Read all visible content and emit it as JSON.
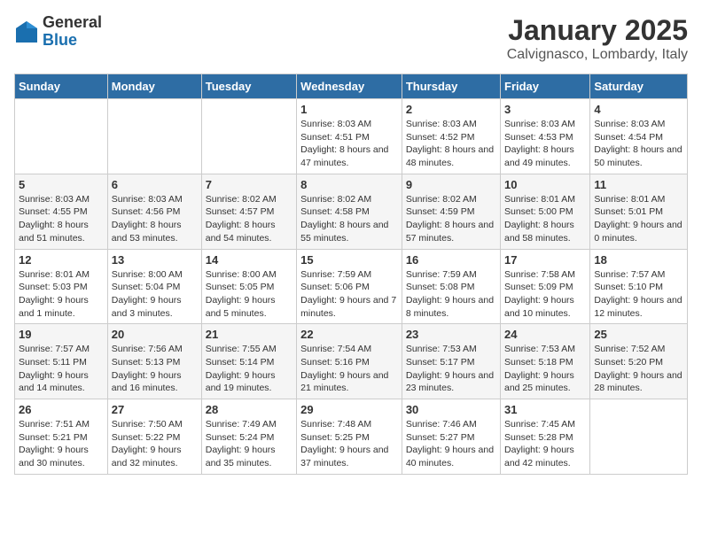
{
  "header": {
    "logo_general": "General",
    "logo_blue": "Blue",
    "month": "January 2025",
    "location": "Calvignasco, Lombardy, Italy"
  },
  "weekdays": [
    "Sunday",
    "Monday",
    "Tuesday",
    "Wednesday",
    "Thursday",
    "Friday",
    "Saturday"
  ],
  "weeks": [
    [
      {
        "day": "",
        "info": ""
      },
      {
        "day": "",
        "info": ""
      },
      {
        "day": "",
        "info": ""
      },
      {
        "day": "1",
        "info": "Sunrise: 8:03 AM\nSunset: 4:51 PM\nDaylight: 8 hours and 47 minutes."
      },
      {
        "day": "2",
        "info": "Sunrise: 8:03 AM\nSunset: 4:52 PM\nDaylight: 8 hours and 48 minutes."
      },
      {
        "day": "3",
        "info": "Sunrise: 8:03 AM\nSunset: 4:53 PM\nDaylight: 8 hours and 49 minutes."
      },
      {
        "day": "4",
        "info": "Sunrise: 8:03 AM\nSunset: 4:54 PM\nDaylight: 8 hours and 50 minutes."
      }
    ],
    [
      {
        "day": "5",
        "info": "Sunrise: 8:03 AM\nSunset: 4:55 PM\nDaylight: 8 hours and 51 minutes."
      },
      {
        "day": "6",
        "info": "Sunrise: 8:03 AM\nSunset: 4:56 PM\nDaylight: 8 hours and 53 minutes."
      },
      {
        "day": "7",
        "info": "Sunrise: 8:02 AM\nSunset: 4:57 PM\nDaylight: 8 hours and 54 minutes."
      },
      {
        "day": "8",
        "info": "Sunrise: 8:02 AM\nSunset: 4:58 PM\nDaylight: 8 hours and 55 minutes."
      },
      {
        "day": "9",
        "info": "Sunrise: 8:02 AM\nSunset: 4:59 PM\nDaylight: 8 hours and 57 minutes."
      },
      {
        "day": "10",
        "info": "Sunrise: 8:01 AM\nSunset: 5:00 PM\nDaylight: 8 hours and 58 minutes."
      },
      {
        "day": "11",
        "info": "Sunrise: 8:01 AM\nSunset: 5:01 PM\nDaylight: 9 hours and 0 minutes."
      }
    ],
    [
      {
        "day": "12",
        "info": "Sunrise: 8:01 AM\nSunset: 5:03 PM\nDaylight: 9 hours and 1 minute."
      },
      {
        "day": "13",
        "info": "Sunrise: 8:00 AM\nSunset: 5:04 PM\nDaylight: 9 hours and 3 minutes."
      },
      {
        "day": "14",
        "info": "Sunrise: 8:00 AM\nSunset: 5:05 PM\nDaylight: 9 hours and 5 minutes."
      },
      {
        "day": "15",
        "info": "Sunrise: 7:59 AM\nSunset: 5:06 PM\nDaylight: 9 hours and 7 minutes."
      },
      {
        "day": "16",
        "info": "Sunrise: 7:59 AM\nSunset: 5:08 PM\nDaylight: 9 hours and 8 minutes."
      },
      {
        "day": "17",
        "info": "Sunrise: 7:58 AM\nSunset: 5:09 PM\nDaylight: 9 hours and 10 minutes."
      },
      {
        "day": "18",
        "info": "Sunrise: 7:57 AM\nSunset: 5:10 PM\nDaylight: 9 hours and 12 minutes."
      }
    ],
    [
      {
        "day": "19",
        "info": "Sunrise: 7:57 AM\nSunset: 5:11 PM\nDaylight: 9 hours and 14 minutes."
      },
      {
        "day": "20",
        "info": "Sunrise: 7:56 AM\nSunset: 5:13 PM\nDaylight: 9 hours and 16 minutes."
      },
      {
        "day": "21",
        "info": "Sunrise: 7:55 AM\nSunset: 5:14 PM\nDaylight: 9 hours and 19 minutes."
      },
      {
        "day": "22",
        "info": "Sunrise: 7:54 AM\nSunset: 5:16 PM\nDaylight: 9 hours and 21 minutes."
      },
      {
        "day": "23",
        "info": "Sunrise: 7:53 AM\nSunset: 5:17 PM\nDaylight: 9 hours and 23 minutes."
      },
      {
        "day": "24",
        "info": "Sunrise: 7:53 AM\nSunset: 5:18 PM\nDaylight: 9 hours and 25 minutes."
      },
      {
        "day": "25",
        "info": "Sunrise: 7:52 AM\nSunset: 5:20 PM\nDaylight: 9 hours and 28 minutes."
      }
    ],
    [
      {
        "day": "26",
        "info": "Sunrise: 7:51 AM\nSunset: 5:21 PM\nDaylight: 9 hours and 30 minutes."
      },
      {
        "day": "27",
        "info": "Sunrise: 7:50 AM\nSunset: 5:22 PM\nDaylight: 9 hours and 32 minutes."
      },
      {
        "day": "28",
        "info": "Sunrise: 7:49 AM\nSunset: 5:24 PM\nDaylight: 9 hours and 35 minutes."
      },
      {
        "day": "29",
        "info": "Sunrise: 7:48 AM\nSunset: 5:25 PM\nDaylight: 9 hours and 37 minutes."
      },
      {
        "day": "30",
        "info": "Sunrise: 7:46 AM\nSunset: 5:27 PM\nDaylight: 9 hours and 40 minutes."
      },
      {
        "day": "31",
        "info": "Sunrise: 7:45 AM\nSunset: 5:28 PM\nDaylight: 9 hours and 42 minutes."
      },
      {
        "day": "",
        "info": ""
      }
    ]
  ]
}
